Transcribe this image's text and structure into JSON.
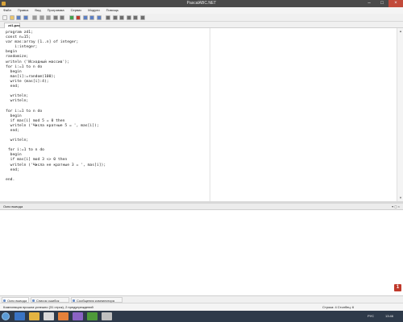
{
  "window": {
    "title": "PascalABC.NET"
  },
  "menu": [
    "Файл",
    "Правка",
    "Вид",
    "Программа",
    "Сервис",
    "Модули",
    "Помощь"
  ],
  "toolbar": {
    "icons": [
      "new-file-icon",
      "open-icon",
      "save-icon",
      "save-all-icon",
      "cut-icon",
      "copy-icon",
      "paste-icon",
      "undo-icon",
      "redo-icon",
      "run-icon",
      "stop-icon",
      "debug-icon",
      "step-into-icon",
      "step-over-icon",
      "layout-icon",
      "layout-icon",
      "layout-icon",
      "format-icon",
      "comment-icon",
      "settings-icon"
    ]
  },
  "file_tab": {
    "label": "zd1.pas",
    "close": "×"
  },
  "code": [
    [
      "program zd1;"
    ],
    [
      "const n=15;"
    ],
    [
      "var mas:array [1..n] of integer;"
    ],
    [
      "    i:integer;"
    ],
    [
      "begin"
    ],
    [
      "randomize;"
    ],
    [
      "writeln ('Исходный массив');"
    ],
    [
      "for i:=1 to n do"
    ],
    [
      "  begin"
    ],
    [
      "  mas[i]:=random(100);"
    ],
    [
      "  write (mas[i]:4);"
    ],
    [
      "  end;"
    ],
    [
      ""
    ],
    [
      "  writeln;"
    ],
    [
      "  writeln;"
    ],
    [
      ""
    ],
    [
      "for i:=1 to n do"
    ],
    [
      "  begin"
    ],
    [
      "  if mas[i] mod 5 = 0 then"
    ],
    [
      "  writeln ('Числа кратные 5 = ', mas[i]);"
    ],
    [
      "  end;"
    ],
    [
      ""
    ],
    [
      "  writeln;"
    ],
    [
      ""
    ],
    [
      " for i:=1 to n do"
    ],
    [
      "  begin"
    ],
    [
      "  if mas[i] mod 3 <> 0 then"
    ],
    [
      "  writeln ('Числа не кратные 3 = ', mas[i]);"
    ],
    [
      "  end;"
    ],
    [
      ""
    ],
    [
      "end."
    ]
  ],
  "output": {
    "title": "Окно вывода",
    "controls": "▾ ◻ ×"
  },
  "bottom_tabs": [
    "Окно вывода",
    "Список ошибок",
    "Сообщения компилятора"
  ],
  "status": {
    "message": "Компиляция прошла успешно (31 строк), 2 предупреждений",
    "position": "Строка: 4  Столбец: 6"
  },
  "taskbar": {
    "lang": "РУС",
    "time": "13:46",
    "badge": "1"
  },
  "colors": {
    "titlebar": "#4a4a4a",
    "taskbar": "#2e3a4a",
    "close_button": "#c24a3a",
    "string_literal": "#1a3fb0"
  }
}
